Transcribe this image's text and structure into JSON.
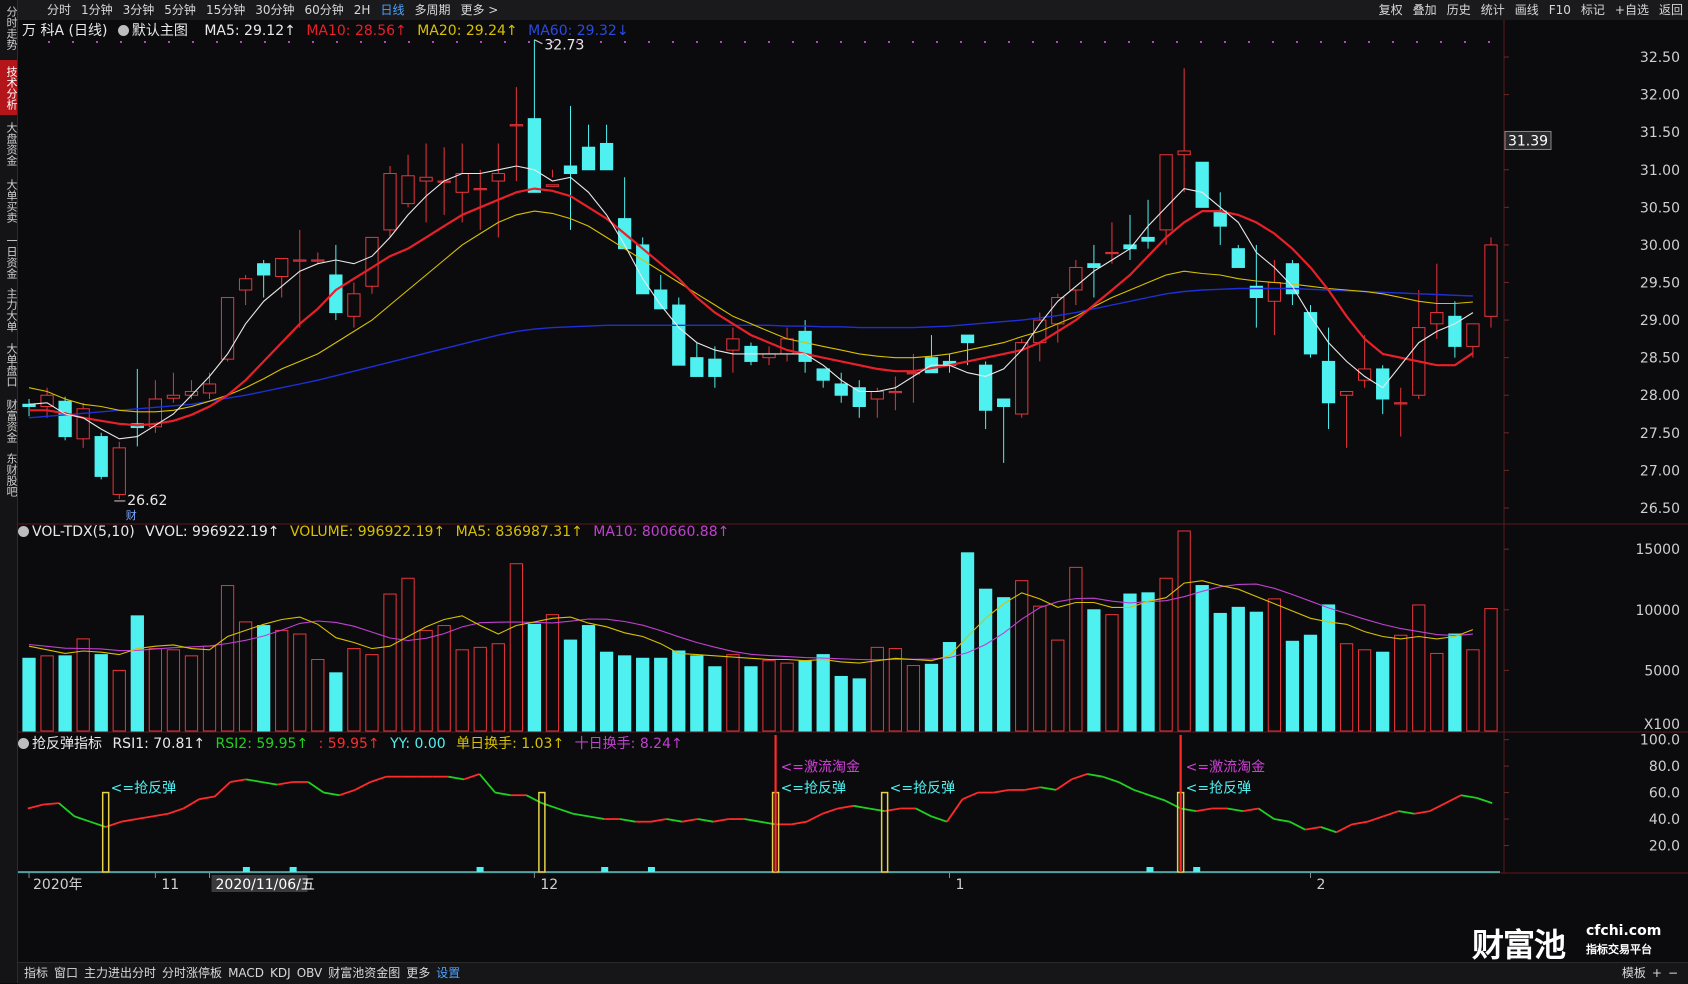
{
  "toolbar": {
    "left": [
      "分时",
      "1分钟",
      "3分钟",
      "5分钟",
      "15分钟",
      "30分钟",
      "60分钟",
      "2H",
      "日线",
      "多周期",
      "更多 >"
    ],
    "active": "日线",
    "right": [
      "复权",
      "叠加",
      "历史",
      "统计",
      "画线",
      "F10",
      "标记",
      "+自选",
      "返回"
    ]
  },
  "left_tabs": [
    {
      "label": "分时走势",
      "active": false
    },
    {
      "label": "技术分析",
      "active": true
    },
    {
      "label": "大盘资金",
      "active": false
    },
    {
      "label": "大单买卖",
      "active": false
    },
    {
      "label": "一日资金",
      "active": false
    },
    {
      "label": "主力大单",
      "active": false
    },
    {
      "label": "大单盘口",
      "active": false
    },
    {
      "label": "财富资金",
      "active": false
    },
    {
      "label": "东财股吧",
      "active": false
    }
  ],
  "main_legend": {
    "stock": "万 科A (日线)",
    "main": "默认主图",
    "ma5": "MA5: 29.12↑",
    "ma10": "MA10: 28.56↑",
    "ma20": "MA20: 29.24↑",
    "ma60": "MA60: 29.32↓"
  },
  "vol_legend": {
    "name": "VOL-TDX(5,10)",
    "vvol": "VVOL: 996922.19↑",
    "volume": "VOLUME: 996922.19↑",
    "ma5": "MA5: 836987.31↑",
    "ma10": "MA10: 800660.88↑"
  },
  "rsi_legend": {
    "name": "抢反弹指标",
    "rsi1": "RSI1: 70.81↑",
    "rsi2": "RSI2: 59.95↑",
    "c3": ": 59.95↑",
    "yy": "YY: 0.00",
    "dhs": "单日换手: 1.03↑",
    "shs": "十日换手: 8.24↑"
  },
  "bottom_tabs": [
    "指标",
    "窗口",
    "主力进出分时",
    "分时涨停板",
    "MACD",
    "KDJ",
    "OBV",
    "财富池资金图",
    "更多",
    "设置"
  ],
  "bottom_active": "设置",
  "bottom_right": [
    "模板",
    "+",
    "−"
  ],
  "logo": {
    "name": "财富池",
    "domain": "cfchi.com",
    "slogan": "指标交易平台"
  },
  "colors": {
    "up": "#e8353b",
    "down": "#4ff0f0",
    "ma5": "#e9e9e9",
    "ma10": "#e8202a",
    "ma20": "#d8c000",
    "ma60": "#1f2fd8",
    "vol_ma5": "#d8c000",
    "vol_ma10": "#c040d0",
    "rsi_up": "#ff2a2a",
    "rsi_down": "#20d020",
    "rebound": "#e4d24a",
    "flow": "#ff2a2a"
  },
  "chart_data": [
    {
      "type": "candlestick",
      "title": "万 科A (日线)",
      "ylim": [
        26.3,
        32.7
      ],
      "yticks": [
        26.5,
        27.0,
        27.5,
        28.0,
        28.5,
        29.0,
        29.5,
        30.0,
        30.5,
        31.0,
        31.5,
        32.0,
        32.5
      ],
      "current_price": "31.39",
      "high_label": "32.73",
      "low_label": "26.62",
      "low_tag": "财",
      "x_labels": [
        {
          "index": 0,
          "text": "2020年"
        },
        {
          "index": 7,
          "text": "11"
        },
        {
          "index": 10,
          "text": "2020/11/06/五"
        },
        {
          "index": 28,
          "text": "12"
        },
        {
          "index": 51,
          "text": "1"
        },
        {
          "index": 71,
          "text": "2"
        }
      ],
      "ohlc": [
        [
          27.88,
          27.95,
          27.72,
          27.85
        ],
        [
          27.85,
          28.1,
          27.7,
          28.0
        ],
        [
          27.92,
          27.98,
          27.4,
          27.45
        ],
        [
          27.42,
          27.9,
          27.3,
          27.82
        ],
        [
          27.45,
          27.5,
          26.88,
          26.92
        ],
        [
          26.68,
          27.38,
          26.62,
          27.3
        ],
        [
          27.62,
          28.35,
          27.32,
          27.57
        ],
        [
          27.58,
          28.2,
          27.5,
          27.95
        ],
        [
          27.96,
          28.3,
          27.9,
          28.0
        ],
        [
          28.0,
          28.2,
          27.95,
          28.05
        ],
        [
          28.03,
          28.3,
          27.95,
          28.15
        ],
        [
          28.48,
          29.3,
          28.45,
          29.3
        ],
        [
          29.4,
          29.6,
          29.2,
          29.55
        ],
        [
          29.75,
          29.8,
          29.3,
          29.6
        ],
        [
          29.58,
          29.7,
          29.3,
          29.82
        ],
        [
          29.8,
          30.2,
          28.9,
          29.8
        ],
        [
          29.8,
          29.9,
          29.75,
          29.8
        ],
        [
          29.6,
          30.0,
          29.0,
          29.1
        ],
        [
          29.05,
          29.5,
          28.9,
          29.35
        ],
        [
          29.45,
          30.1,
          29.35,
          30.1
        ],
        [
          30.2,
          31.05,
          30.1,
          30.95
        ],
        [
          30.55,
          31.2,
          30.5,
          30.92
        ],
        [
          30.85,
          31.35,
          30.3,
          30.9
        ],
        [
          30.85,
          31.3,
          30.4,
          30.85
        ],
        [
          30.7,
          31.35,
          30.3,
          30.95
        ],
        [
          30.75,
          31.0,
          30.2,
          30.75
        ],
        [
          30.85,
          31.35,
          30.1,
          30.95
        ],
        [
          31.6,
          32.1,
          30.85,
          31.6
        ],
        [
          31.68,
          32.73,
          31.05,
          30.7
        ],
        [
          30.78,
          31.0,
          30.9,
          30.8
        ],
        [
          31.05,
          31.85,
          30.2,
          30.95
        ],
        [
          31.3,
          31.6,
          31.2,
          31.0
        ],
        [
          31.35,
          31.6,
          31.0,
          31.0
        ],
        [
          30.35,
          30.9,
          29.95,
          29.95
        ],
        [
          30.0,
          30.1,
          29.4,
          29.35
        ],
        [
          29.4,
          29.6,
          29.15,
          29.15
        ],
        [
          29.2,
          29.3,
          28.5,
          28.4
        ],
        [
          28.5,
          28.7,
          28.25,
          28.25
        ],
        [
          28.48,
          28.65,
          28.1,
          28.25
        ],
        [
          28.6,
          28.9,
          28.3,
          28.75
        ],
        [
          28.65,
          28.7,
          28.4,
          28.45
        ],
        [
          28.5,
          28.65,
          28.4,
          28.55
        ],
        [
          28.55,
          28.9,
          28.45,
          28.75
        ],
        [
          28.85,
          29.0,
          28.3,
          28.45
        ],
        [
          28.35,
          28.3,
          28.1,
          28.2
        ],
        [
          28.15,
          28.3,
          27.9,
          28.0
        ],
        [
          28.1,
          28.2,
          27.7,
          27.85
        ],
        [
          27.95,
          28.1,
          27.7,
          28.05
        ],
        [
          28.05,
          28.25,
          27.8,
          28.05
        ],
        [
          28.3,
          28.55,
          27.9,
          28.3
        ],
        [
          28.5,
          28.8,
          28.4,
          28.3
        ],
        [
          28.45,
          28.55,
          28.3,
          28.4
        ],
        [
          28.8,
          28.8,
          28.4,
          28.7
        ],
        [
          28.4,
          28.45,
          27.55,
          27.8
        ],
        [
          27.95,
          27.95,
          27.1,
          27.85
        ],
        [
          27.75,
          28.75,
          27.7,
          28.7
        ],
        [
          28.7,
          29.1,
          28.45,
          29.0
        ],
        [
          28.95,
          29.35,
          28.7,
          29.3
        ],
        [
          29.4,
          29.8,
          29.2,
          29.7
        ],
        [
          29.75,
          30.0,
          29.3,
          29.7
        ],
        [
          29.9,
          30.3,
          29.75,
          29.9
        ],
        [
          30.0,
          30.4,
          29.8,
          29.95
        ],
        [
          30.1,
          30.6,
          29.95,
          30.05
        ],
        [
          30.2,
          31.2,
          30.0,
          31.2
        ],
        [
          31.2,
          32.35,
          30.7,
          31.25
        ],
        [
          31.1,
          31.1,
          30.5,
          30.5
        ],
        [
          30.45,
          30.7,
          30.0,
          30.25
        ],
        [
          29.95,
          30.0,
          29.8,
          29.7
        ],
        [
          29.45,
          30.0,
          28.9,
          29.3
        ],
        [
          29.25,
          29.8,
          28.8,
          29.5
        ],
        [
          29.75,
          29.8,
          29.2,
          29.35
        ],
        [
          29.1,
          29.2,
          28.5,
          28.55
        ],
        [
          28.45,
          28.9,
          27.55,
          27.9
        ],
        [
          28.0,
          28.05,
          27.3,
          28.05
        ],
        [
          28.2,
          28.8,
          28.1,
          28.35
        ],
        [
          28.35,
          28.4,
          27.75,
          27.95
        ],
        [
          27.9,
          28.1,
          27.45,
          27.9
        ],
        [
          28.0,
          29.4,
          27.95,
          28.9
        ],
        [
          28.95,
          29.75,
          28.75,
          29.1
        ],
        [
          29.05,
          29.25,
          28.5,
          28.65
        ],
        [
          28.65,
          28.9,
          28.5,
          28.95
        ],
        [
          29.05,
          30.1,
          28.9,
          30.0
        ]
      ],
      "ma5": [
        27.88,
        27.9,
        27.75,
        27.7,
        27.55,
        27.42,
        27.45,
        27.6,
        27.75,
        28.0,
        28.25,
        28.55,
        28.95,
        29.25,
        29.45,
        29.65,
        29.75,
        29.8,
        29.75,
        29.85,
        30.1,
        30.4,
        30.65,
        30.85,
        30.95,
        30.95,
        31.0,
        31.05,
        31.0,
        30.85,
        30.9,
        30.7,
        30.4,
        30.0,
        29.55,
        29.2,
        28.9,
        28.7,
        28.6,
        28.55,
        28.55,
        28.55,
        28.55,
        28.55,
        28.4,
        28.2,
        28.05,
        28.05,
        28.1,
        28.25,
        28.4,
        28.4,
        28.3,
        28.25,
        28.35,
        28.6,
        28.95,
        29.25,
        29.45,
        29.65,
        29.8,
        29.95,
        30.25,
        30.5,
        30.75,
        30.7,
        30.5,
        30.3,
        29.9,
        29.7,
        29.45,
        29.05,
        28.7,
        28.45,
        28.25,
        28.1,
        28.4,
        28.7,
        28.85,
        28.95,
        29.1
      ],
      "ma10": [
        27.8,
        27.8,
        27.76,
        27.7,
        27.66,
        27.62,
        27.6,
        27.62,
        27.66,
        27.74,
        27.85,
        28.0,
        28.2,
        28.45,
        28.7,
        28.95,
        29.15,
        29.4,
        29.55,
        29.7,
        29.85,
        29.95,
        30.1,
        30.25,
        30.4,
        30.5,
        30.6,
        30.7,
        30.75,
        30.72,
        30.65,
        30.5,
        30.35,
        30.15,
        29.95,
        29.75,
        29.55,
        29.3,
        29.1,
        28.95,
        28.8,
        28.7,
        28.6,
        28.55,
        28.5,
        28.45,
        28.4,
        28.35,
        28.32,
        28.32,
        28.36,
        28.4,
        28.45,
        28.5,
        28.55,
        28.6,
        28.7,
        28.85,
        29.0,
        29.2,
        29.4,
        29.6,
        29.85,
        30.1,
        30.3,
        30.45,
        30.45,
        30.4,
        30.3,
        30.15,
        29.95,
        29.7,
        29.4,
        29.05,
        28.75,
        28.55,
        28.5,
        28.45,
        28.4,
        28.4,
        28.56
      ],
      "ma20": [
        28.1,
        28.05,
        27.95,
        27.88,
        27.85,
        27.8,
        27.78,
        27.78,
        27.8,
        27.85,
        27.92,
        28.0,
        28.1,
        28.22,
        28.35,
        28.45,
        28.55,
        28.7,
        28.85,
        29.0,
        29.2,
        29.4,
        29.6,
        29.8,
        30.0,
        30.15,
        30.3,
        30.4,
        30.45,
        30.42,
        30.35,
        30.25,
        30.1,
        29.95,
        29.8,
        29.65,
        29.5,
        29.35,
        29.2,
        29.05,
        28.95,
        28.85,
        28.75,
        28.7,
        28.65,
        28.6,
        28.55,
        28.52,
        28.5,
        28.5,
        28.52,
        28.55,
        28.6,
        28.65,
        28.7,
        28.78,
        28.85,
        28.95,
        29.05,
        29.18,
        29.3,
        29.4,
        29.5,
        29.6,
        29.65,
        29.62,
        29.6,
        29.55,
        29.52,
        29.5,
        29.48,
        29.45,
        29.42,
        29.4,
        29.38,
        29.35,
        29.3,
        29.25,
        29.22,
        29.22,
        29.24
      ],
      "ma60": [
        27.7,
        27.72,
        27.74,
        27.76,
        27.78,
        27.8,
        27.82,
        27.84,
        27.86,
        27.88,
        27.92,
        27.96,
        28.0,
        28.05,
        28.1,
        28.15,
        28.2,
        28.26,
        28.32,
        28.38,
        28.44,
        28.5,
        28.56,
        28.62,
        28.68,
        28.74,
        28.8,
        28.85,
        28.88,
        28.9,
        28.91,
        28.92,
        28.93,
        28.93,
        28.93,
        28.93,
        28.93,
        28.93,
        28.93,
        28.93,
        28.93,
        28.93,
        28.92,
        28.92,
        28.91,
        28.91,
        28.9,
        28.9,
        28.9,
        28.9,
        28.91,
        28.92,
        28.94,
        28.96,
        28.98,
        29.0,
        29.03,
        29.06,
        29.1,
        29.15,
        29.2,
        29.25,
        29.3,
        29.35,
        29.38,
        29.4,
        29.41,
        29.42,
        29.42,
        29.42,
        29.42,
        29.41,
        29.4,
        29.39,
        29.38,
        29.37,
        29.36,
        29.35,
        29.34,
        29.33,
        29.32
      ]
    },
    {
      "type": "bar",
      "title": "VOL-TDX(5,10)",
      "ylim": [
        0,
        16500
      ],
      "yticks": [
        5000,
        10000,
        15000
      ],
      "unit": "X100",
      "volume": [
        6000,
        6200,
        6200,
        7600,
        6300,
        5000,
        9500,
        6800,
        6700,
        6200,
        7000,
        12000,
        9000,
        8700,
        8300,
        8000,
        5900,
        4800,
        6800,
        6300,
        11300,
        12600,
        8300,
        8700,
        6700,
        6900,
        7200,
        13800,
        8800,
        9600,
        7500,
        8700,
        6500,
        6200,
        6000,
        6000,
        6600,
        6200,
        5300,
        6300,
        5300,
        5800,
        5600,
        5800,
        6300,
        4500,
        4300,
        6900,
        6800,
        5400,
        5500,
        7300,
        14700,
        11700,
        11000,
        12400,
        10300,
        7500,
        13500,
        10000,
        9600,
        11300,
        11400,
        12600,
        16500,
        12000,
        9700,
        10200,
        9800,
        10900,
        7400,
        7900,
        10400,
        7200,
        6700,
        6500,
        7900,
        10400,
        6400,
        8000,
        6700,
        10100
      ],
      "ma5": [
        7000,
        6700,
        6400,
        6600,
        6500,
        6300,
        6800,
        7000,
        7100,
        6800,
        6700,
        7800,
        8300,
        8800,
        9200,
        9400,
        8800,
        7700,
        7300,
        6800,
        7000,
        7800,
        8600,
        9200,
        9500,
        8700,
        8000,
        8700,
        9000,
        9300,
        9400,
        8900,
        8600,
        8100,
        7800,
        7200,
        6400,
        6300,
        6200,
        6100,
        6000,
        5900,
        5900,
        5800,
        5900,
        5700,
        5600,
        5800,
        6000,
        5900,
        5800,
        6200,
        7800,
        9300,
        10500,
        11400,
        10900,
        10200,
        10600,
        10600,
        10200,
        10200,
        10700,
        11000,
        12200,
        12400,
        12000,
        11700,
        11100,
        10500,
        9900,
        9300,
        9000,
        8800,
        8200,
        7800,
        7600,
        7800,
        7600,
        7800,
        8369
      ]
    },
    {
      "type": "line",
      "title": "抢反弹指标",
      "ylim": [
        0,
        105
      ],
      "yticks": [
        20,
        40,
        60,
        80,
        100
      ],
      "rsi1": [
        48,
        51,
        52,
        42,
        38,
        34,
        38,
        40,
        42,
        44,
        48,
        55,
        57,
        68,
        70,
        68,
        66,
        68,
        68,
        60,
        58,
        62,
        68,
        72,
        72,
        72,
        72,
        72,
        70,
        74,
        60,
        58,
        58,
        52,
        48,
        44,
        42,
        40,
        40,
        38,
        38,
        40,
        38,
        40,
        38,
        40,
        40,
        38,
        36,
        36,
        38,
        44,
        48,
        50,
        48,
        46,
        48,
        48,
        42,
        38,
        55,
        60,
        60,
        62,
        62,
        64,
        62,
        70,
        74,
        72,
        68,
        62,
        58,
        54,
        48,
        46,
        48,
        48,
        46,
        48,
        40,
        38,
        32,
        34,
        30,
        36,
        38,
        42,
        46,
        44,
        46,
        52,
        58,
        56,
        52
      ],
      "sell_signals": [
        48,
        74
      ],
      "rebound_signals": [
        5,
        33,
        48,
        55,
        74
      ],
      "flow_signals": [
        48,
        74
      ],
      "signal_labels": [
        {
          "index": 5,
          "text": "<=抢反弹"
        },
        {
          "index": 48,
          "text": "<=激流淘金"
        },
        {
          "index": 48,
          "text": "<=抢反弹"
        },
        {
          "index": 55,
          "text": "<=抢反弹"
        },
        {
          "index": 74,
          "text": "<=激流淘金"
        },
        {
          "index": 74,
          "text": "<=抢反弹"
        }
      ],
      "bottom_markers": [
        14,
        17,
        29,
        37,
        40,
        72,
        75
      ]
    }
  ]
}
